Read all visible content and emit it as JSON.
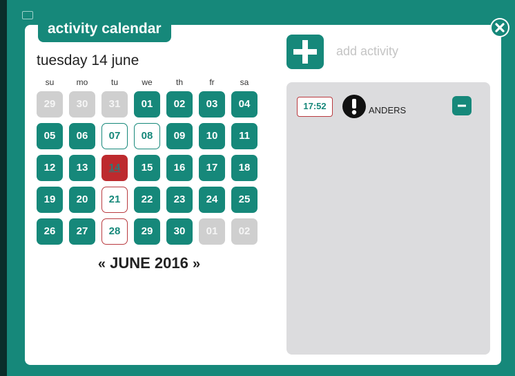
{
  "header": {
    "title": "activity calendar"
  },
  "calendar": {
    "selected_date": "tuesday 14 june",
    "weekdays": [
      "su",
      "mo",
      "tu",
      "we",
      "th",
      "fr",
      "sa"
    ],
    "weeks": [
      [
        {
          "d": "29",
          "s": "other"
        },
        {
          "d": "30",
          "s": "other"
        },
        {
          "d": "31",
          "s": "other"
        },
        {
          "d": "01",
          "s": "cur"
        },
        {
          "d": "02",
          "s": "cur"
        },
        {
          "d": "03",
          "s": "cur"
        },
        {
          "d": "04",
          "s": "cur"
        }
      ],
      [
        {
          "d": "05",
          "s": "cur"
        },
        {
          "d": "06",
          "s": "cur"
        },
        {
          "d": "07",
          "s": "outline"
        },
        {
          "d": "08",
          "s": "outline"
        },
        {
          "d": "09",
          "s": "cur"
        },
        {
          "d": "10",
          "s": "cur"
        },
        {
          "d": "11",
          "s": "cur"
        }
      ],
      [
        {
          "d": "12",
          "s": "cur"
        },
        {
          "d": "13",
          "s": "cur"
        },
        {
          "d": "14",
          "s": "today"
        },
        {
          "d": "15",
          "s": "cur"
        },
        {
          "d": "16",
          "s": "cur"
        },
        {
          "d": "17",
          "s": "cur"
        },
        {
          "d": "18",
          "s": "cur"
        }
      ],
      [
        {
          "d": "19",
          "s": "cur"
        },
        {
          "d": "20",
          "s": "cur"
        },
        {
          "d": "21",
          "s": "redout"
        },
        {
          "d": "22",
          "s": "cur"
        },
        {
          "d": "23",
          "s": "cur"
        },
        {
          "d": "24",
          "s": "cur"
        },
        {
          "d": "25",
          "s": "cur"
        }
      ],
      [
        {
          "d": "26",
          "s": "cur"
        },
        {
          "d": "27",
          "s": "cur"
        },
        {
          "d": "28",
          "s": "redout"
        },
        {
          "d": "29",
          "s": "cur"
        },
        {
          "d": "30",
          "s": "cur"
        },
        {
          "d": "01",
          "s": "other"
        },
        {
          "d": "02",
          "s": "other"
        }
      ]
    ],
    "month_label": "JUNE 2016",
    "prev_label": "«",
    "next_label": "»"
  },
  "activities": {
    "add_label": "add activity",
    "items": [
      {
        "time": "17:52",
        "name": "ANDERS"
      }
    ]
  },
  "icons": {
    "close": "close-icon",
    "add": "plus-icon",
    "remove": "minus-icon",
    "alert": "exclamation-icon",
    "cast": "cast-icon"
  },
  "colors": {
    "accent": "#16887a",
    "today": "#bd2a2e",
    "other_month": "#cfcfcf",
    "activity_panel": "#dcdcde"
  }
}
